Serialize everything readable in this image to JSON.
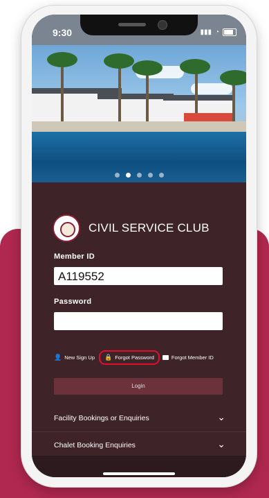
{
  "status_bar": {
    "time": "9:30"
  },
  "hero": {
    "slide_count": 5,
    "active_slide_index": 0
  },
  "brand": {
    "club_name": "CIVIL SERVICE CLUB",
    "logo_text": "CIVIL SERVICE CLUB SINGAPORE"
  },
  "form": {
    "member_id_label": "Member ID",
    "member_id_value": "A119552",
    "password_label": "Password",
    "password_value": ""
  },
  "links": {
    "new_signup": "New Sign Up",
    "forgot_password": "Forgot Password",
    "forgot_member_id": "Forgot Member ID"
  },
  "login_button": "Login",
  "accordions": [
    {
      "title": "Facility Bookings or Enquiries"
    },
    {
      "title": "Chalet Booking Enquiries"
    }
  ],
  "colors": {
    "panel_bg": "#3e2328",
    "backdrop": "#b0284f",
    "highlight": "#e0102c"
  }
}
